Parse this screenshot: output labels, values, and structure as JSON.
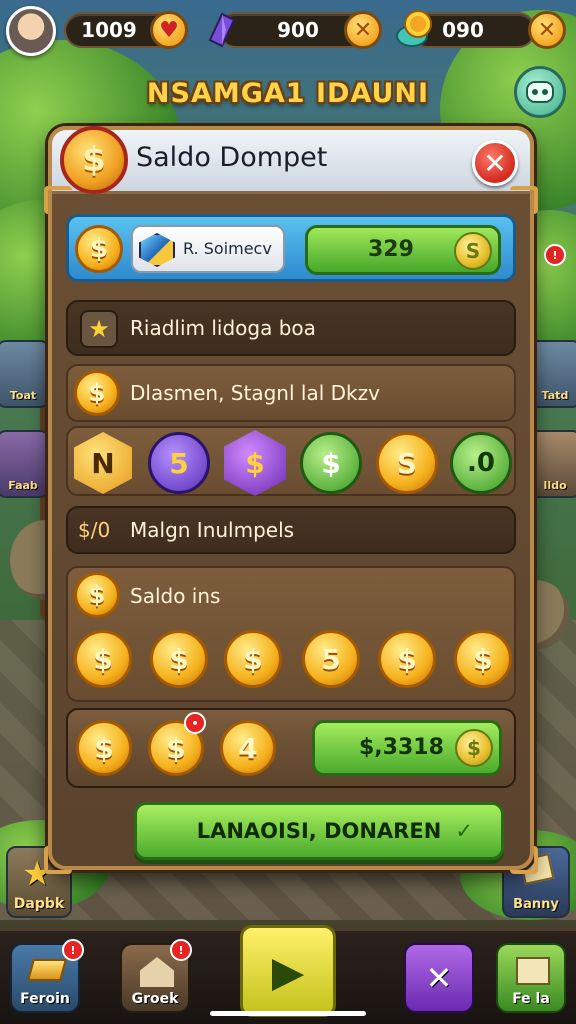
{
  "topbar": {
    "hearts_value": "1009",
    "gems_value": "900",
    "coins_value": "090",
    "hearts_add_label": "♥",
    "gems_add_label": "✕",
    "coins_add_label": "✕"
  },
  "zone_title": "NSAMGA1 IDAUNI",
  "left_side": {
    "item1_label": "Toat",
    "item2_label": "Faab",
    "item3_label": "Dapbk"
  },
  "right_side": {
    "item1_label": "Tatd",
    "item2_label": "Ildo",
    "item3_label": "Banny"
  },
  "panel": {
    "title": "Saldo Dompet",
    "close_label": "✕",
    "balance_row": {
      "coin_symbol": "$",
      "account_name": "R. Soimecv",
      "amount": "329",
      "amount_coin_symbol": "S"
    },
    "row2_label": "Riadlim lidoga boa",
    "row3_label": "Dlasmen, Stagnl lal Dkzv",
    "token_icons": [
      "N",
      "5",
      "$",
      "$",
      "S",
      ".0"
    ],
    "row5_prefix": "$/0",
    "row5_label": "Malgn Inulmpels",
    "row6_label": "Saldo ins",
    "coin_grid_labels": [
      "$",
      "$",
      "$",
      "5",
      "$",
      "$"
    ],
    "bottom_coins_labels": [
      "$",
      "$",
      "4"
    ],
    "total_amount": "$,3318",
    "total_coin_symbol": "$",
    "action_button_label": "LANAOISI, DONAREN",
    "action_button_check": "✓"
  },
  "bottombar": {
    "btn1_label": "Feroin",
    "btn1_badge": "!",
    "btn2_label": "Groek",
    "btn2_badge": "!",
    "play_symbol": "▶",
    "btn4_symbol": "✕",
    "btn5_label": "Fe la"
  },
  "colors": {
    "panel_bg": "#6b5034",
    "accent_green": "#4bab2c",
    "accent_gold": "#f6b21d",
    "close_red": "#d22a1e"
  }
}
